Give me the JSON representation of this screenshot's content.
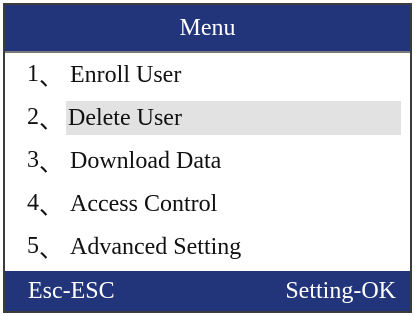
{
  "header": {
    "title": "Menu"
  },
  "menu": {
    "separator": "、",
    "items": [
      {
        "number": "1",
        "label": "Enroll User"
      },
      {
        "number": "2",
        "label": "Delete User"
      },
      {
        "number": "3",
        "label": "Download Data"
      },
      {
        "number": "4",
        "label": "Access Control"
      },
      {
        "number": "5",
        "label": "Advanced Setting"
      }
    ],
    "selected_index": 1
  },
  "footer": {
    "left_hint": "Esc-ESC",
    "right_hint": "Setting-OK"
  },
  "colors": {
    "title_bar_bg": "#22347a",
    "status_bar_bg": "#22347a",
    "selection_bg": "#e2e2e2"
  }
}
